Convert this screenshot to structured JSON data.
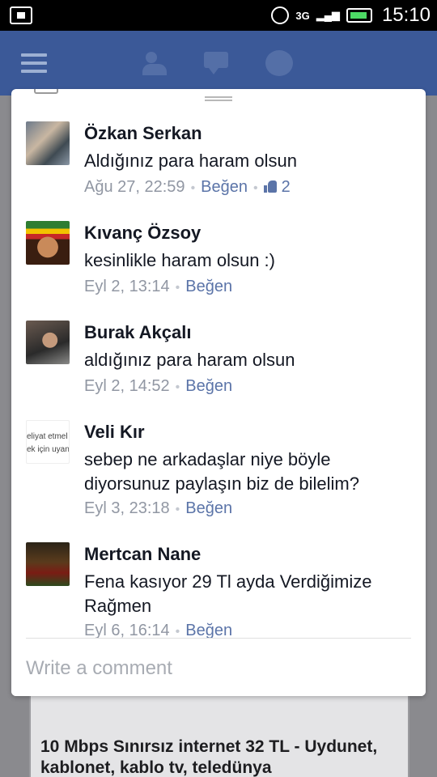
{
  "status_bar": {
    "network": "3G",
    "time": "15:10"
  },
  "app_bar": {
    "icons": [
      "menu-icon",
      "friends-icon",
      "messages-icon",
      "globe-icon"
    ]
  },
  "background_post": {
    "title": "10 Mbps Sınırsız internet 32 TL - Uydunet, kablonet, kablo tv, teledünya"
  },
  "comments": [
    {
      "author": "Özkan Serkan",
      "text": "Aldığınız para haram olsun",
      "timestamp": "Ağu 27, 22:59",
      "like_label": "Beğen",
      "like_count": "2"
    },
    {
      "author": "Kıvanç Özsoy",
      "text": "kesinlikle haram olsun :)",
      "timestamp": "Eyl 2, 13:14",
      "like_label": "Beğen"
    },
    {
      "author": "Burak Akçalı",
      "text": "aldığınız para haram olsun",
      "timestamp": "Eyl 2, 14:52",
      "like_label": "Beğen"
    },
    {
      "author": "Veli Kır",
      "text": "sebep ne arkadaşlar niye böyle diyorsunuz paylaşın biz de bilelim?",
      "timestamp": "Eyl 3, 23:18",
      "like_label": "Beğen",
      "avatar_text": [
        "eliyat etmel",
        "ek için uyan"
      ]
    },
    {
      "author": "Mertcan Nane",
      "text": "Fena kasıyor 29 Tl ayda Verdiğimize Rağmen",
      "timestamp": "Eyl 6, 16:14",
      "like_label": "Beğen"
    }
  ],
  "composer": {
    "placeholder": "Write a comment"
  },
  "colors": {
    "brand": "#3b5998",
    "link": "#5b74a8",
    "muted": "#9197a3"
  }
}
